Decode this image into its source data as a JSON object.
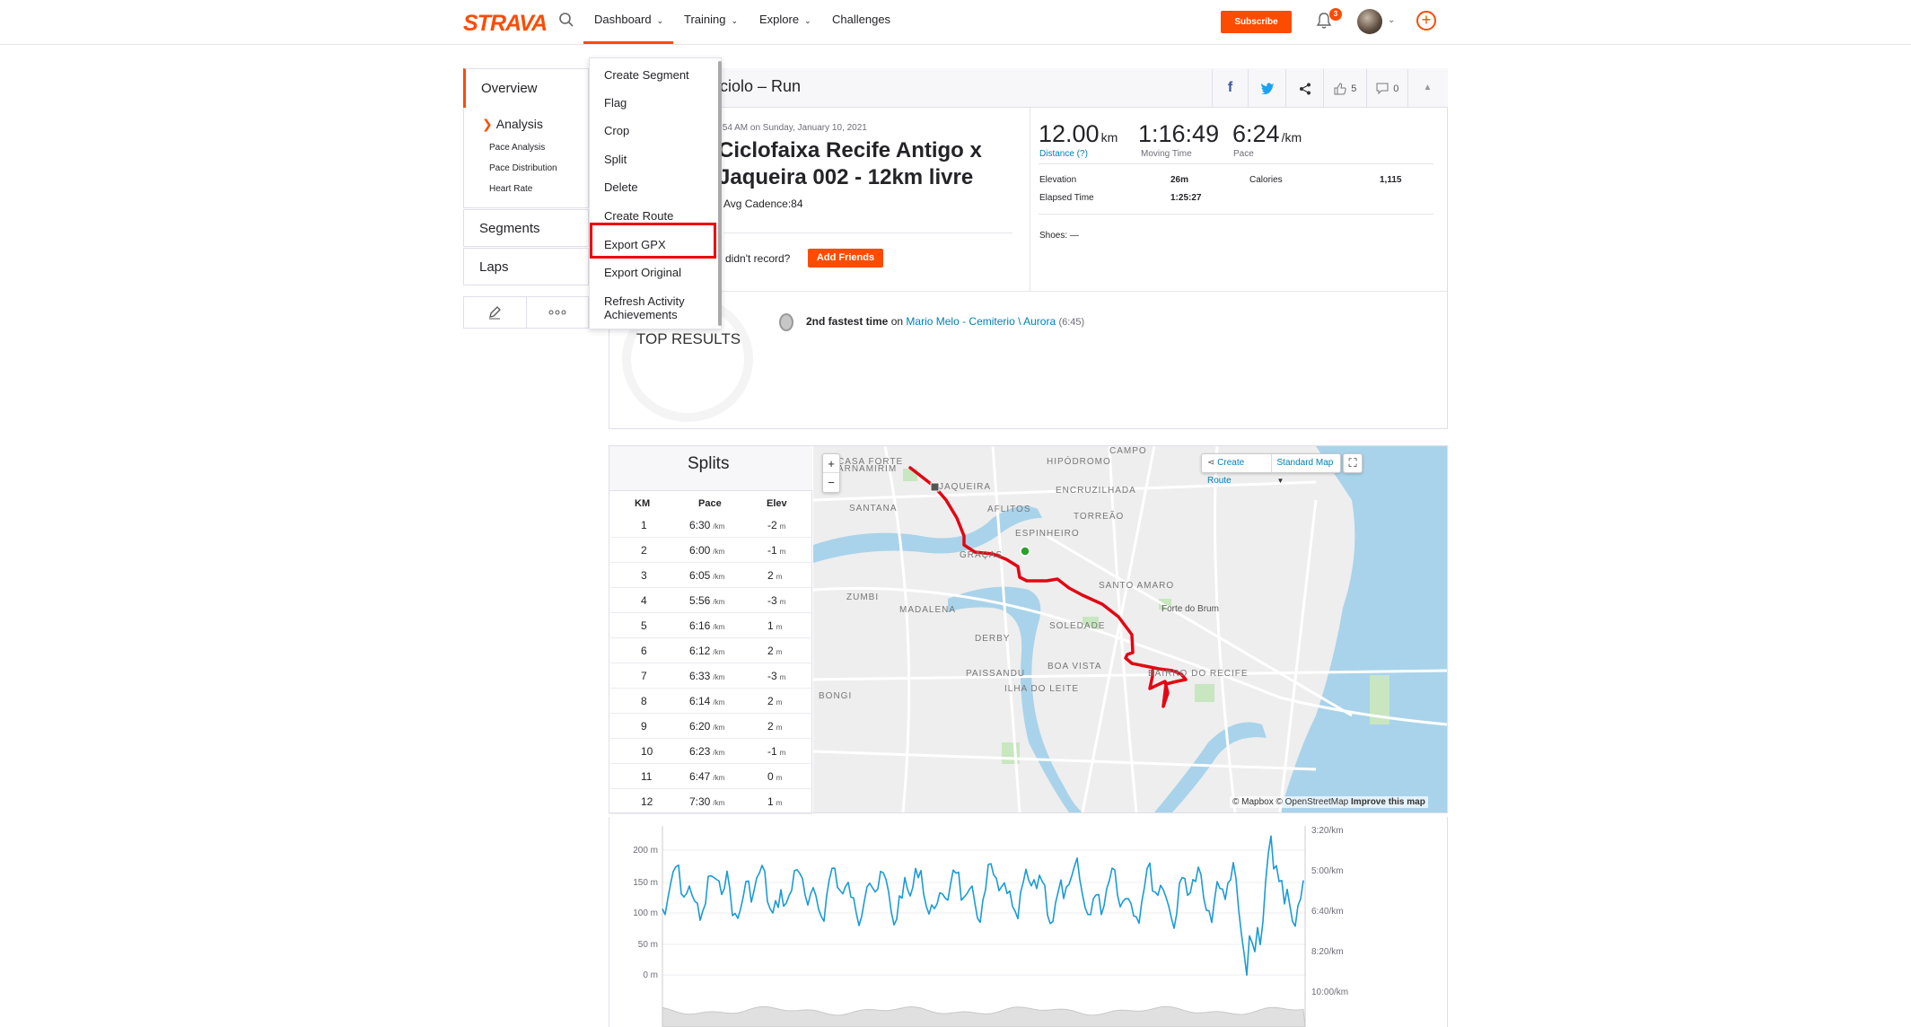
{
  "nav": {
    "logo": "STRAVA",
    "items": [
      {
        "label": "Dashboard",
        "chev": "⌄"
      },
      {
        "label": "Training",
        "chev": "⌄"
      },
      {
        "label": "Explore",
        "chev": "⌄"
      },
      {
        "label": "Challenges",
        "chev": ""
      }
    ],
    "subscribe": "Subscribe",
    "notifications_count": "3"
  },
  "sidebar": {
    "overview": "Overview",
    "analysis": "Analysis",
    "analysis_items": [
      "Pace Analysis",
      "Pace Distribution",
      "Heart Rate"
    ],
    "segments": "Segments",
    "laps": "Laps"
  },
  "activity": {
    "header_title": "ciolo – Run",
    "kudos": "5",
    "comments": "0",
    "date": ":54 AM on Sunday, January 10, 2021",
    "name": "Ciclofaixa Recife Antigo x Jaqueira 002 - 12km livre",
    "cadence": "Avg Cadence:84",
    "didnt_record": "didn't record?",
    "add_friends": "Add Friends",
    "stats": {
      "distance": {
        "value": "12.00",
        "unit": "km",
        "label": "Distance (?)"
      },
      "moving_time": {
        "value": "1:16:49",
        "label": "Moving Time"
      },
      "pace": {
        "value": "6:24",
        "unit": "/km",
        "label": "Pace"
      }
    },
    "details": {
      "elevation_label": "Elevation",
      "elevation": "26m",
      "calories_label": "Calories",
      "calories": "1,115",
      "elapsed_label": "Elapsed Time",
      "elapsed": "1:25:27",
      "shoes": "Shoes: —"
    },
    "top_results": "TOP RESULTS",
    "achievement": {
      "rank": "2nd fastest time",
      "on": "on",
      "segment": "Mario Melo - Cemiterio \\ Aurora",
      "time": "(6:45)"
    }
  },
  "dropdown": {
    "items": [
      "Create Segment",
      "Flag",
      "Crop",
      "Split",
      "Delete",
      "Create Route",
      "Export GPX",
      "Export Original",
      "Refresh Activity Achievements"
    ]
  },
  "splits": {
    "title": "Splits",
    "headers": [
      "KM",
      "Pace",
      "Elev"
    ],
    "pace_unit": "/km",
    "elev_unit": "m",
    "rows": [
      {
        "km": "1",
        "pace": "6:30",
        "elev": "-2"
      },
      {
        "km": "2",
        "pace": "6:00",
        "elev": "-1"
      },
      {
        "km": "3",
        "pace": "6:05",
        "elev": "2"
      },
      {
        "km": "4",
        "pace": "5:56",
        "elev": "-3"
      },
      {
        "km": "5",
        "pace": "6:16",
        "elev": "1"
      },
      {
        "km": "6",
        "pace": "6:12",
        "elev": "2"
      },
      {
        "km": "7",
        "pace": "6:33",
        "elev": "-3"
      },
      {
        "km": "8",
        "pace": "6:14",
        "elev": "2"
      },
      {
        "km": "9",
        "pace": "6:20",
        "elev": "2"
      },
      {
        "km": "10",
        "pace": "6:23",
        "elev": "-1"
      },
      {
        "km": "11",
        "pace": "6:47",
        "elev": "0"
      },
      {
        "km": "12",
        "pace": "7:30",
        "elev": "1"
      }
    ]
  },
  "map": {
    "create_route": "Create Route",
    "map_type": "Standard Map",
    "zoom_in": "+",
    "zoom_out": "−",
    "attribution": "© Mapbox © OpenStreetMap",
    "improve": "Improve this map",
    "labels": [
      "CAMPO",
      "PARNAMIRIM",
      "CASA FORTE",
      "JAQUEIRA",
      "HIPÓDROMO",
      "ENCRUZILHADA",
      "SANTANA",
      "AFLITOS",
      "TORREÃO",
      "ESPINHEIRO",
      "GRAÇAS",
      "SANTO AMARO",
      "ZUMBI",
      "MADALENA",
      "Forte do Brum",
      "DERBY",
      "SOLEDADE",
      "BOA VISTA",
      "PAISSANDU",
      "ILHA DO LEITE",
      "BONGI",
      "BAIRRO DO RECIFE"
    ]
  },
  "chart": {
    "left_ticks": [
      "200 m",
      "150 m",
      "100 m",
      "50 m",
      "0 m"
    ],
    "right_ticks": [
      "3:20/km",
      "5:00/km",
      "6:40/km",
      "8:20/km",
      "10:00/km"
    ]
  },
  "colors": {
    "brand": "#fc4c02",
    "route": "#e30613",
    "link": "#007fb6",
    "chart_line": "#1a9bd7"
  }
}
